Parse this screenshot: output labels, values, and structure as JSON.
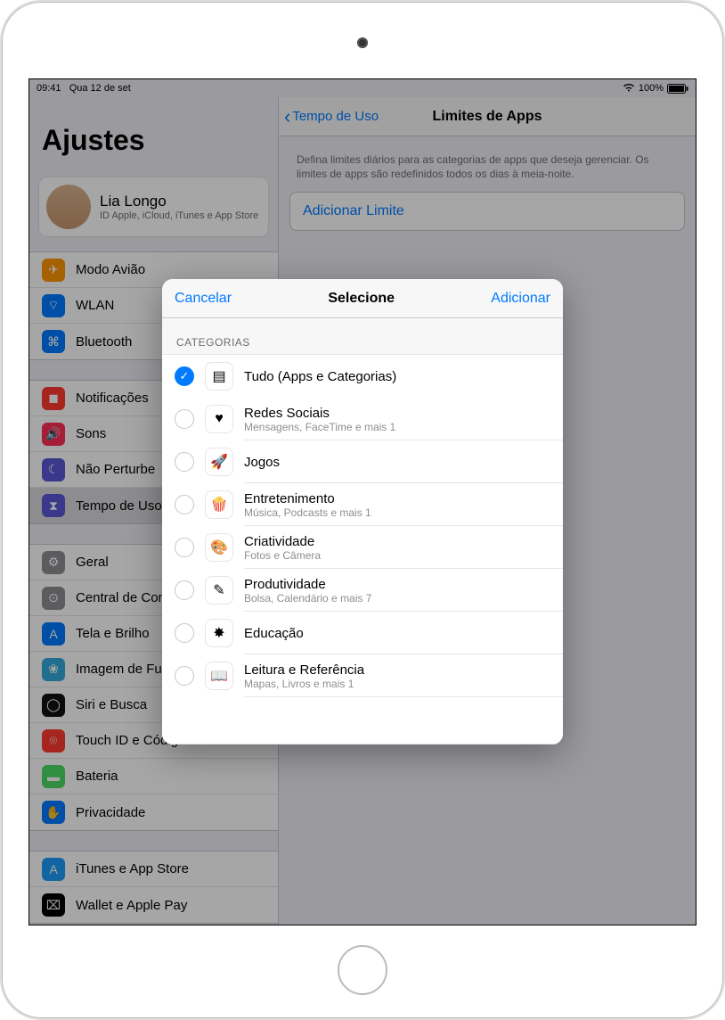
{
  "status": {
    "time": "09:41",
    "date": "Qua 12 de set",
    "battery": "100%"
  },
  "sidebar": {
    "title": "Ajustes",
    "profile": {
      "name": "Lia Longo",
      "sub": "ID Apple, iCloud, iTunes e App Store"
    },
    "items": [
      {
        "label": "Modo Avião",
        "icon": "✈",
        "color": "#ff9500"
      },
      {
        "label": "WLAN",
        "icon": "⌔",
        "color": "#007aff"
      },
      {
        "label": "Bluetooth",
        "icon": "⌘",
        "color": "#007aff"
      },
      {
        "label": "Notificações",
        "icon": "◼",
        "color": "#ff3b30"
      },
      {
        "label": "Sons",
        "icon": "🔊",
        "color": "#ff2d55"
      },
      {
        "label": "Não Perturbe",
        "icon": "☾",
        "color": "#5856d6"
      },
      {
        "label": "Tempo de Uso",
        "icon": "⧗",
        "color": "#5856d6",
        "selected": true
      },
      {
        "label": "Geral",
        "icon": "⚙",
        "color": "#8e8e93"
      },
      {
        "label": "Central de Controle",
        "icon": "⊙",
        "color": "#8e8e93"
      },
      {
        "label": "Tela e Brilho",
        "icon": "A",
        "color": "#007aff"
      },
      {
        "label": "Imagem de Fundo",
        "icon": "❀",
        "color": "#34aadc"
      },
      {
        "label": "Siri e Busca",
        "icon": "◯",
        "color": "#111"
      },
      {
        "label": "Touch ID e Código",
        "icon": "⌾",
        "color": "#ff3b30"
      },
      {
        "label": "Bateria",
        "icon": "▬",
        "color": "#4cd964"
      },
      {
        "label": "Privacidade",
        "icon": "✋",
        "color": "#007aff"
      },
      {
        "label": "iTunes e App Store",
        "icon": "A",
        "color": "#1d9bf6"
      },
      {
        "label": "Wallet e Apple Pay",
        "icon": "⌧",
        "color": "#000"
      }
    ]
  },
  "detail": {
    "back": "Tempo de Uso",
    "title": "Limites de Apps",
    "desc": "Defina limites diários para as categorias de apps que deseja gerenciar. Os limites de apps são redefinidos todos os dias à meia-noite.",
    "add": "Adicionar Limite"
  },
  "modal": {
    "cancel": "Cancelar",
    "title": "Selecione",
    "confirm": "Adicionar",
    "section": "CATEGORIAS",
    "categories": [
      {
        "title": "Tudo (Apps e Categorias)",
        "sub": "",
        "icon": "▤",
        "checked": true
      },
      {
        "title": "Redes Sociais",
        "sub": "Mensagens, FaceTime e mais 1",
        "icon": "♥"
      },
      {
        "title": "Jogos",
        "sub": "",
        "icon": "🚀"
      },
      {
        "title": "Entretenimento",
        "sub": "Música, Podcasts e mais 1",
        "icon": "🍿"
      },
      {
        "title": "Criatividade",
        "sub": "Fotos e Câmera",
        "icon": "🎨"
      },
      {
        "title": "Produtividade",
        "sub": "Bolsa, Calendário e mais 7",
        "icon": "✎"
      },
      {
        "title": "Educação",
        "sub": "",
        "icon": "✸"
      },
      {
        "title": "Leitura e Referência",
        "sub": "Mapas, Livros e mais 1",
        "icon": "📖"
      }
    ]
  }
}
